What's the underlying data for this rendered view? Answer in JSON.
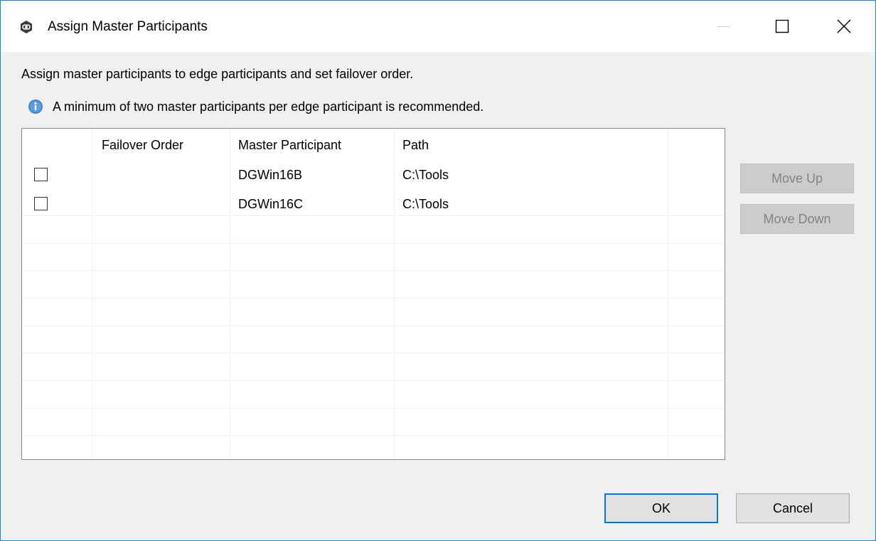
{
  "window": {
    "title": "Assign Master Participants",
    "controls": {
      "minimize": "minimize-icon",
      "maximize": "maximize-icon",
      "close": "close-icon"
    }
  },
  "intro_text": "Assign master participants to edge participants and set failover order.",
  "info": {
    "icon": "info-icon",
    "text": "A minimum of two master participants per edge participant is recommended."
  },
  "table": {
    "columns": [
      "",
      "Failover Order",
      "Master Participant",
      "Path"
    ],
    "rows": [
      {
        "checked": false,
        "failover_order": "",
        "master_participant": "DGWin16B",
        "path": "C:\\Tools"
      },
      {
        "checked": false,
        "failover_order": "",
        "master_participant": "DGWin16C",
        "path": "C:\\Tools"
      }
    ]
  },
  "buttons": {
    "move_up": "Move Up",
    "move_down": "Move Down",
    "ok": "OK",
    "cancel": "Cancel"
  },
  "colors": {
    "window_border": "#1883d7",
    "dialog_background": "#f0f0f0",
    "default_button_border": "#0078d7",
    "info_icon": "#3d86d8",
    "disabled_text": "#838383"
  }
}
